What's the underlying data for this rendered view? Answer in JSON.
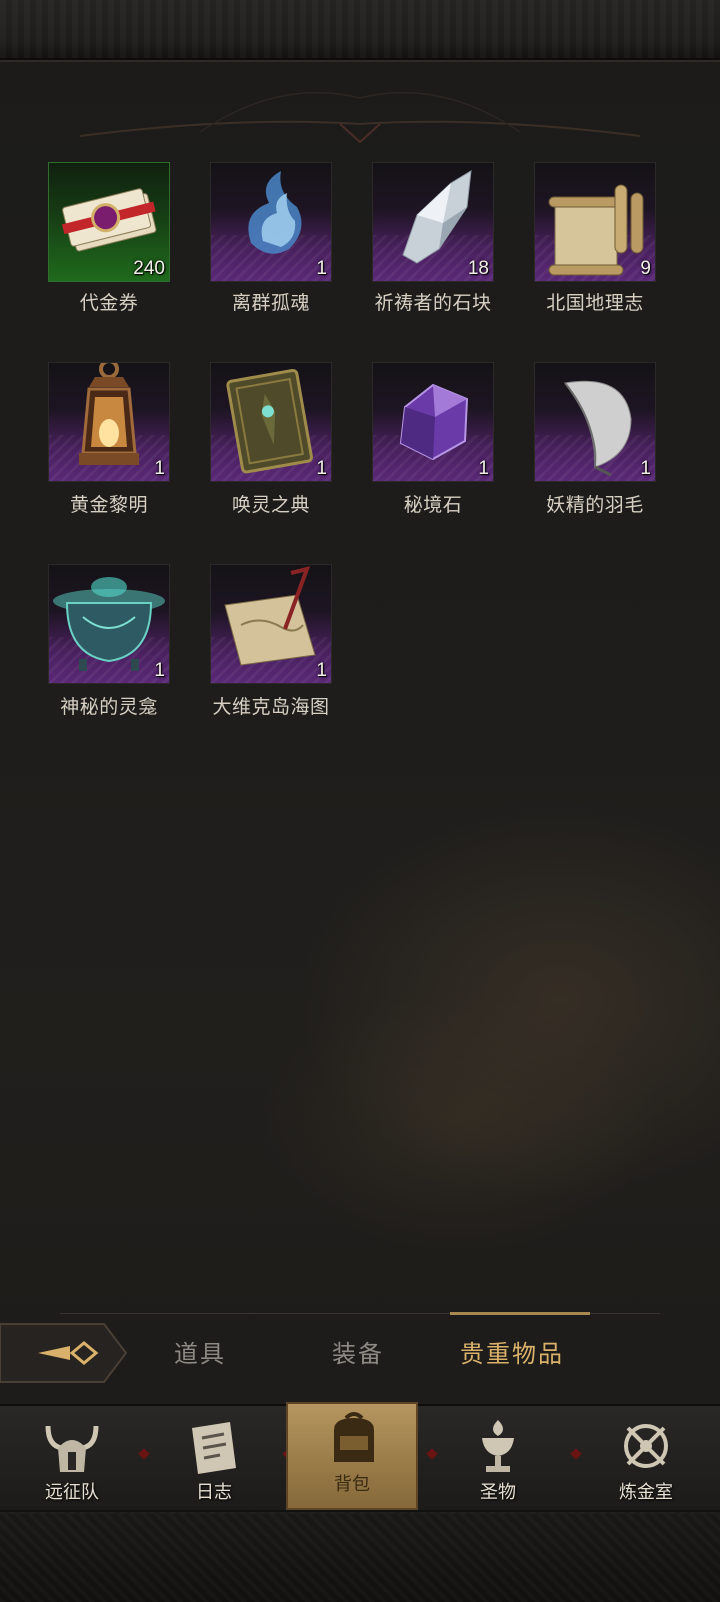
{
  "inventory": {
    "items": [
      {
        "name": "代金券",
        "count": "240",
        "icon": "voucher-bundle-icon",
        "rarity": "green"
      },
      {
        "name": "离群孤魂",
        "count": "1",
        "icon": "blue-spirit-flame-icon",
        "rarity": "purple"
      },
      {
        "name": "祈祷者的石块",
        "count": "18",
        "icon": "crystal-stone-icon",
        "rarity": "purple"
      },
      {
        "name": "北国地理志",
        "count": "9",
        "icon": "scroll-icon",
        "rarity": "purple"
      },
      {
        "name": "黄金黎明",
        "count": "1",
        "icon": "lantern-icon",
        "rarity": "purple"
      },
      {
        "name": "唤灵之典",
        "count": "1",
        "icon": "tome-icon",
        "rarity": "purple"
      },
      {
        "name": "秘境石",
        "count": "1",
        "icon": "amethyst-icon",
        "rarity": "purple"
      },
      {
        "name": "妖精的羽毛",
        "count": "1",
        "icon": "feather-icon",
        "rarity": "purple"
      },
      {
        "name": "神秘的灵龛",
        "count": "1",
        "icon": "censer-icon",
        "rarity": "purple"
      },
      {
        "name": "大维克岛海图",
        "count": "1",
        "icon": "sea-map-icon",
        "rarity": "purple"
      }
    ]
  },
  "tabs": {
    "items": [
      {
        "label": "道具",
        "active": false
      },
      {
        "label": "装备",
        "active": false
      },
      {
        "label": "贵重物品",
        "active": true
      }
    ],
    "back_icon": "arrow-back-icon"
  },
  "nav": {
    "items": [
      {
        "label": "远征队",
        "icon": "horned-helmet-icon",
        "active": false
      },
      {
        "label": "日志",
        "icon": "journal-icon",
        "active": false
      },
      {
        "label": "背包",
        "icon": "backpack-icon",
        "active": true
      },
      {
        "label": "圣物",
        "icon": "chalice-icon",
        "active": false
      },
      {
        "label": "炼金室",
        "icon": "alchemy-icon",
        "active": false
      }
    ]
  },
  "colors": {
    "accent_gold": "#d9b16a",
    "rarity_purple": "#5a2877",
    "rarity_green": "#1f6a1c",
    "nav_active": "#b59660"
  }
}
